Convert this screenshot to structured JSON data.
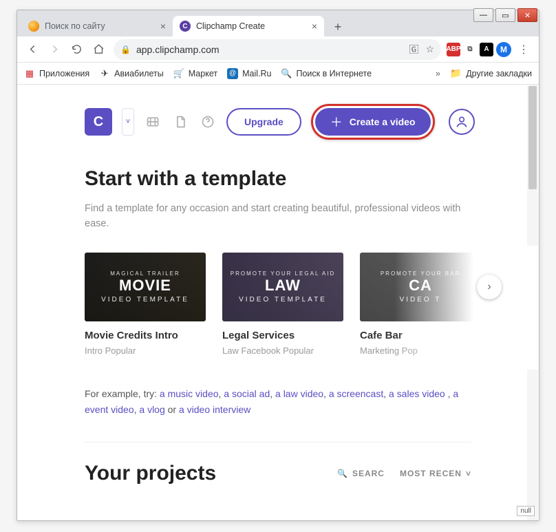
{
  "browser": {
    "tabs": [
      {
        "title": "Поиск по сайту",
        "favicon": "orange-circle",
        "active": false
      },
      {
        "title": "Clipchamp Create",
        "favicon": "purple-c",
        "active": true
      }
    ],
    "toolbar": {
      "url": "app.clipchamp.com"
    },
    "bookmarks": {
      "apps": "Приложения",
      "flights": "Авиабилеты",
      "market": "Маркет",
      "mail": "Mail.Ru",
      "search": "Поиск в Интернете",
      "other": "Другие закладки"
    },
    "avatar_letter": "M",
    "abp_label": "ABP",
    "pdf_label": "A"
  },
  "app": {
    "logo_letter": "C",
    "upgrade_label": "Upgrade",
    "create_label": "Create a video"
  },
  "templates": {
    "heading": "Start with a template",
    "sub": "Find a template for any occasion and start creating beautiful, professional videos with ease.",
    "cards": [
      {
        "eyebrow": "MAGICAL TRAILER",
        "title_big": "MOVIE",
        "subline": "VIDEO TEMPLATE",
        "name": "Movie Credits Intro",
        "tags": "Intro Popular"
      },
      {
        "eyebrow": "PROMOTE YOUR LEGAL AID",
        "title_big": "LAW",
        "subline": "VIDEO TEMPLATE",
        "name": "Legal Services",
        "tags": "Law Facebook Popular"
      },
      {
        "eyebrow": "PROMOTE YOUR BAR",
        "title_big": "CA",
        "subline": "VIDEO T",
        "name": "Cafe Bar",
        "tags": "Marketing Pop"
      }
    ],
    "examples_prefix": "For example, try: ",
    "examples_connector_or": " or ",
    "example_links": {
      "music": "a music video",
      "social": "a social ad",
      "law": "a law video",
      "screencast": "a screencast",
      "sales": "a sales video",
      "event": "a event video",
      "vlog": "a vlog",
      "interview": "a video interview"
    }
  },
  "projects": {
    "heading": "Your projects",
    "search_label": "SEARC",
    "sort_label": "MOST RECEN"
  },
  "corner": "null"
}
